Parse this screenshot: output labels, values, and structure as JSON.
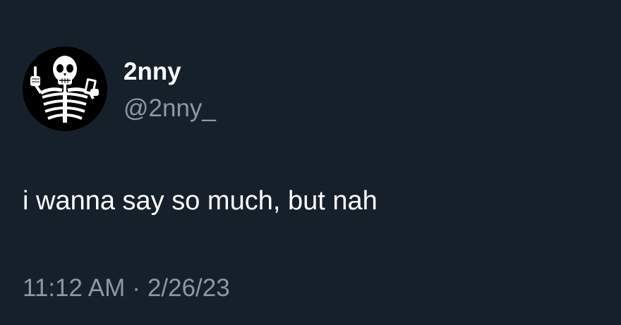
{
  "tweet": {
    "author": {
      "display_name": "2nny",
      "handle": "@2nny_",
      "avatar_icon": "skeleton-icon"
    },
    "text": "i wanna say so much, but nah",
    "time": "11:12 AM",
    "separator": "·",
    "date": "2/26/23"
  },
  "colors": {
    "background": "#15202b",
    "primary_text": "#ffffff",
    "secondary_text": "#8b98a5"
  }
}
